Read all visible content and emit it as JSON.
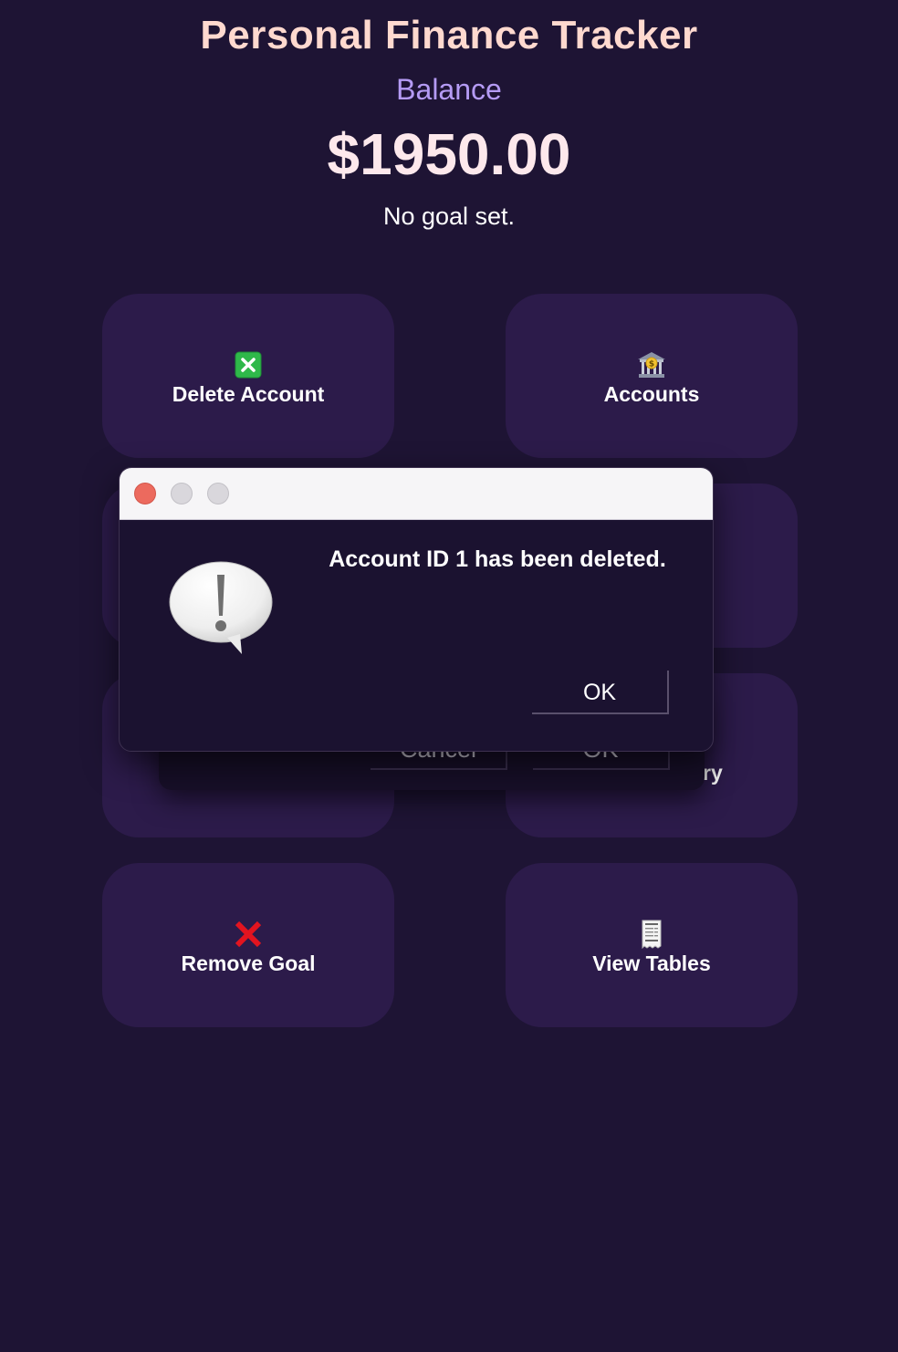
{
  "header": {
    "title": "Personal Finance Tracker",
    "balance_label": "Balance",
    "balance_value": "$1950.00",
    "goal_status": "No goal set."
  },
  "cards": {
    "delete_account": {
      "label": "Delete Account",
      "icon": "cross-mark-button-icon"
    },
    "accounts": {
      "label": "Accounts",
      "icon": "bank-icon"
    },
    "partial_label": "ry",
    "remove_goal": {
      "label": "Remove Goal",
      "icon": "cross-mark-icon"
    },
    "view_tables": {
      "label": "View Tables",
      "icon": "receipt-icon"
    }
  },
  "background_dialog": {
    "cancel_label": "Cancel",
    "ok_label": "OK"
  },
  "alert": {
    "message": "Account ID 1 has been deleted.",
    "ok_label": "OK",
    "icon": "exclamation-bubble-icon"
  },
  "colors": {
    "background": "#1e1434",
    "card": "#2c1b4a",
    "title": "#ffd9cf",
    "accent": "#b59bf5",
    "close": "#ec6a5e"
  }
}
